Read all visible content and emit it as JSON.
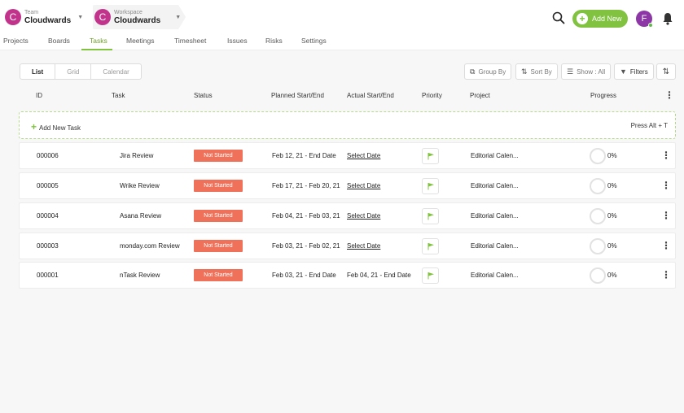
{
  "topbar": {
    "team": {
      "initial": "C",
      "sub": "Team",
      "name": "Cloudwards"
    },
    "workspace": {
      "initial": "C",
      "sub": "Workspace",
      "name": "Cloudwards"
    },
    "add_new_label": "Add New",
    "avatar_initial": "F"
  },
  "tabs": [
    {
      "label": "Projects"
    },
    {
      "label": "Boards"
    },
    {
      "label": "Tasks",
      "active": true
    },
    {
      "label": "Meetings"
    },
    {
      "label": "Timesheet"
    },
    {
      "label": "Issues"
    },
    {
      "label": "Risks"
    },
    {
      "label": "Settings"
    }
  ],
  "view_switch": {
    "list": "List",
    "grid": "Grid",
    "calendar": "Calendar"
  },
  "toolbar": {
    "group_by": "Group By",
    "sort_by": "Sort By",
    "show": "Show : All",
    "filters": "Filters"
  },
  "columns": {
    "id": "ID",
    "task": "Task",
    "status": "Status",
    "planned": "Planned Start/End",
    "actual": "Actual Start/End",
    "priority": "Priority",
    "project": "Project",
    "progress": "Progress"
  },
  "add_task": {
    "label": "Add New Task",
    "shortcut": "Press Alt + T"
  },
  "rows": [
    {
      "id": "000006",
      "task": "Jira Review",
      "status": "Not Started",
      "planned": "Feb 12, 21 - End Date",
      "actual": "Select Date",
      "actual_link": true,
      "project": "Editorial Calen...",
      "progress": "0%"
    },
    {
      "id": "000005",
      "task": "Wrike Review",
      "status": "Not Started",
      "planned": "Feb 17, 21 - Feb 20, 21",
      "actual": "Select Date",
      "actual_link": true,
      "project": "Editorial Calen...",
      "progress": "0%"
    },
    {
      "id": "000004",
      "task": "Asana Review",
      "status": "Not Started",
      "planned": "Feb 04, 21 - Feb 03, 21",
      "actual": "Select Date",
      "actual_link": true,
      "project": "Editorial Calen...",
      "progress": "0%"
    },
    {
      "id": "000003",
      "task": "monday.com Review",
      "status": "Not Started",
      "planned": "Feb 03, 21 - Feb 02, 21",
      "actual": "Select Date",
      "actual_link": true,
      "project": "Editorial Calen...",
      "progress": "0%"
    },
    {
      "id": "000001",
      "task": "nTask Review",
      "status": "Not Started",
      "planned": "Feb 03, 21 - End Date",
      "actual": "Feb 04, 21 - End Date",
      "actual_link": false,
      "project": "Editorial Calen...",
      "progress": "0%"
    }
  ],
  "colors": {
    "accent": "#81c341",
    "status_not_started": "#f0715a",
    "workspace_chip": "#c2338c",
    "avatar": "#8d36a6"
  },
  "icons": [
    "search-icon",
    "plus-icon",
    "bell-icon",
    "group-by-icon",
    "sort-icon",
    "show-icon",
    "filter-icon",
    "sort-toggle-icon",
    "flag-icon",
    "kebab-icon"
  ]
}
